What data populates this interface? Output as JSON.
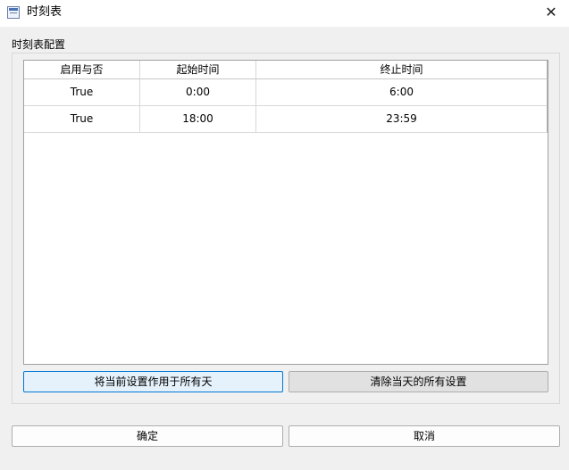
{
  "window": {
    "title": "时刻表",
    "close_glyph": "✕"
  },
  "group": {
    "label": "时刻表配置"
  },
  "table": {
    "columns": [
      "启用与否",
      "起始时间",
      "终止时间"
    ],
    "rows": [
      [
        "True",
        "0:00",
        "6:00"
      ],
      [
        "True",
        "18:00",
        "23:59"
      ]
    ]
  },
  "actions": {
    "apply_all_label": "将当前设置作用于所有天",
    "clear_day_label": "清除当天的所有设置"
  },
  "dialog": {
    "ok_label": "确定",
    "cancel_label": "取消"
  },
  "icons": {
    "title_icon": "schedule-table-icon",
    "close_icon": "close-icon"
  }
}
